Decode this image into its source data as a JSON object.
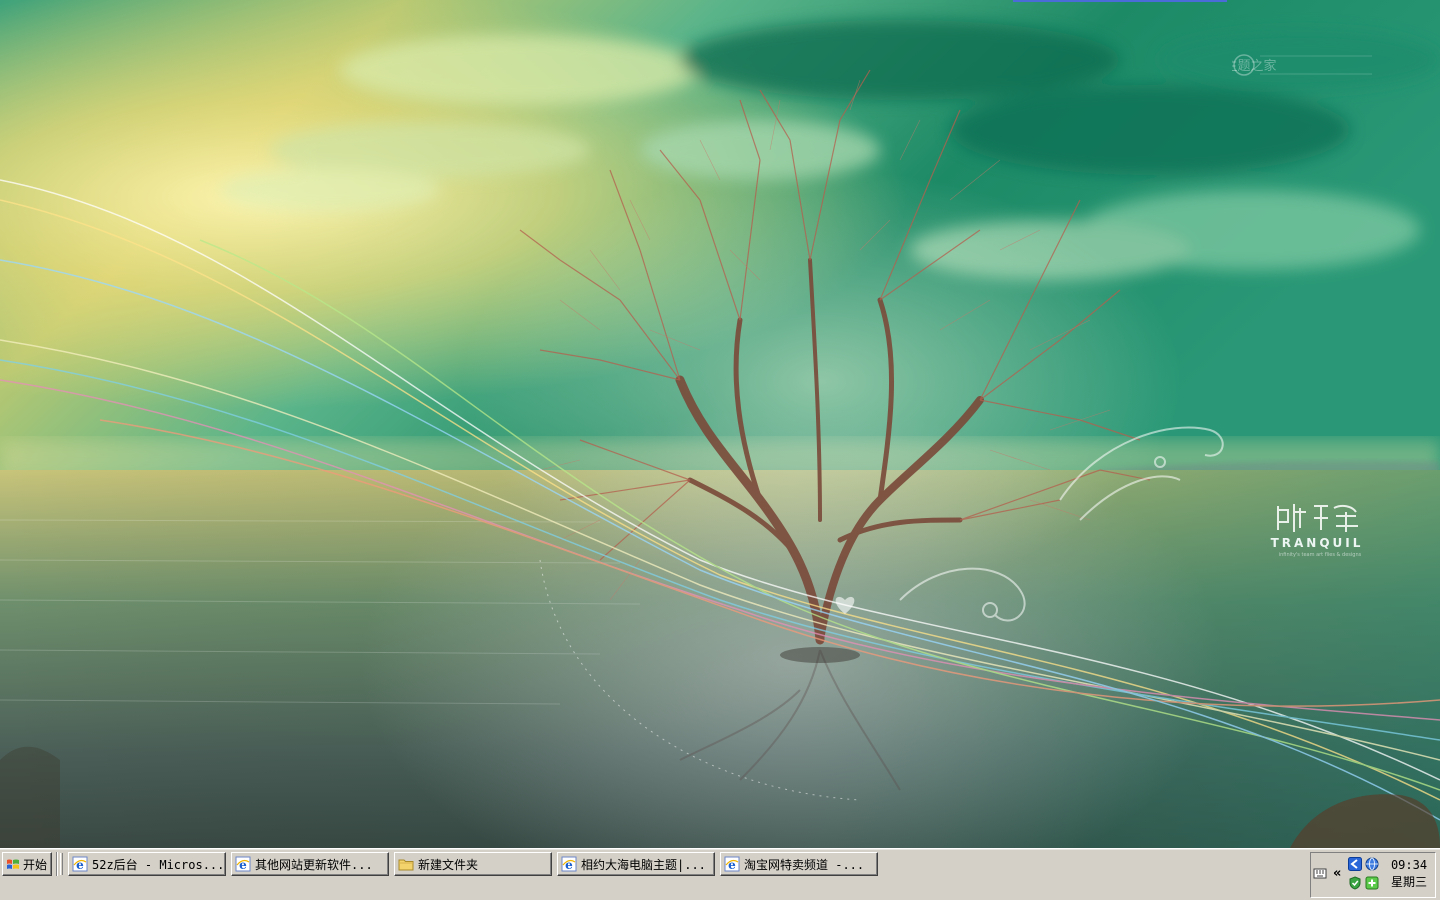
{
  "desktop": {
    "watermark": "@主题之家",
    "wallpaper_brand": {
      "name": "TRANQUIL",
      "subtitle": "infinity's team art flies & designs"
    }
  },
  "taskbar": {
    "start_label": "开始",
    "tasks": [
      {
        "label": "52z后台 - Micros...",
        "icon": "ie-icon"
      },
      {
        "label": "其他网站更新软件...",
        "icon": "ie-icon"
      },
      {
        "label": "新建文件夹",
        "icon": "folder-icon"
      },
      {
        "label": "相约大海电脑主题|...",
        "icon": "ie-icon"
      },
      {
        "label": "淘宝网特卖频道 -...",
        "icon": "ie-icon"
      }
    ],
    "tray": {
      "expand_glyph": "«",
      "time": "09:34",
      "weekday": "星期三"
    }
  },
  "colors": {
    "taskbar_bg": "#d4d0c8",
    "sky_green": "#1f8a66",
    "sunset_yellow": "#f2e38a"
  }
}
